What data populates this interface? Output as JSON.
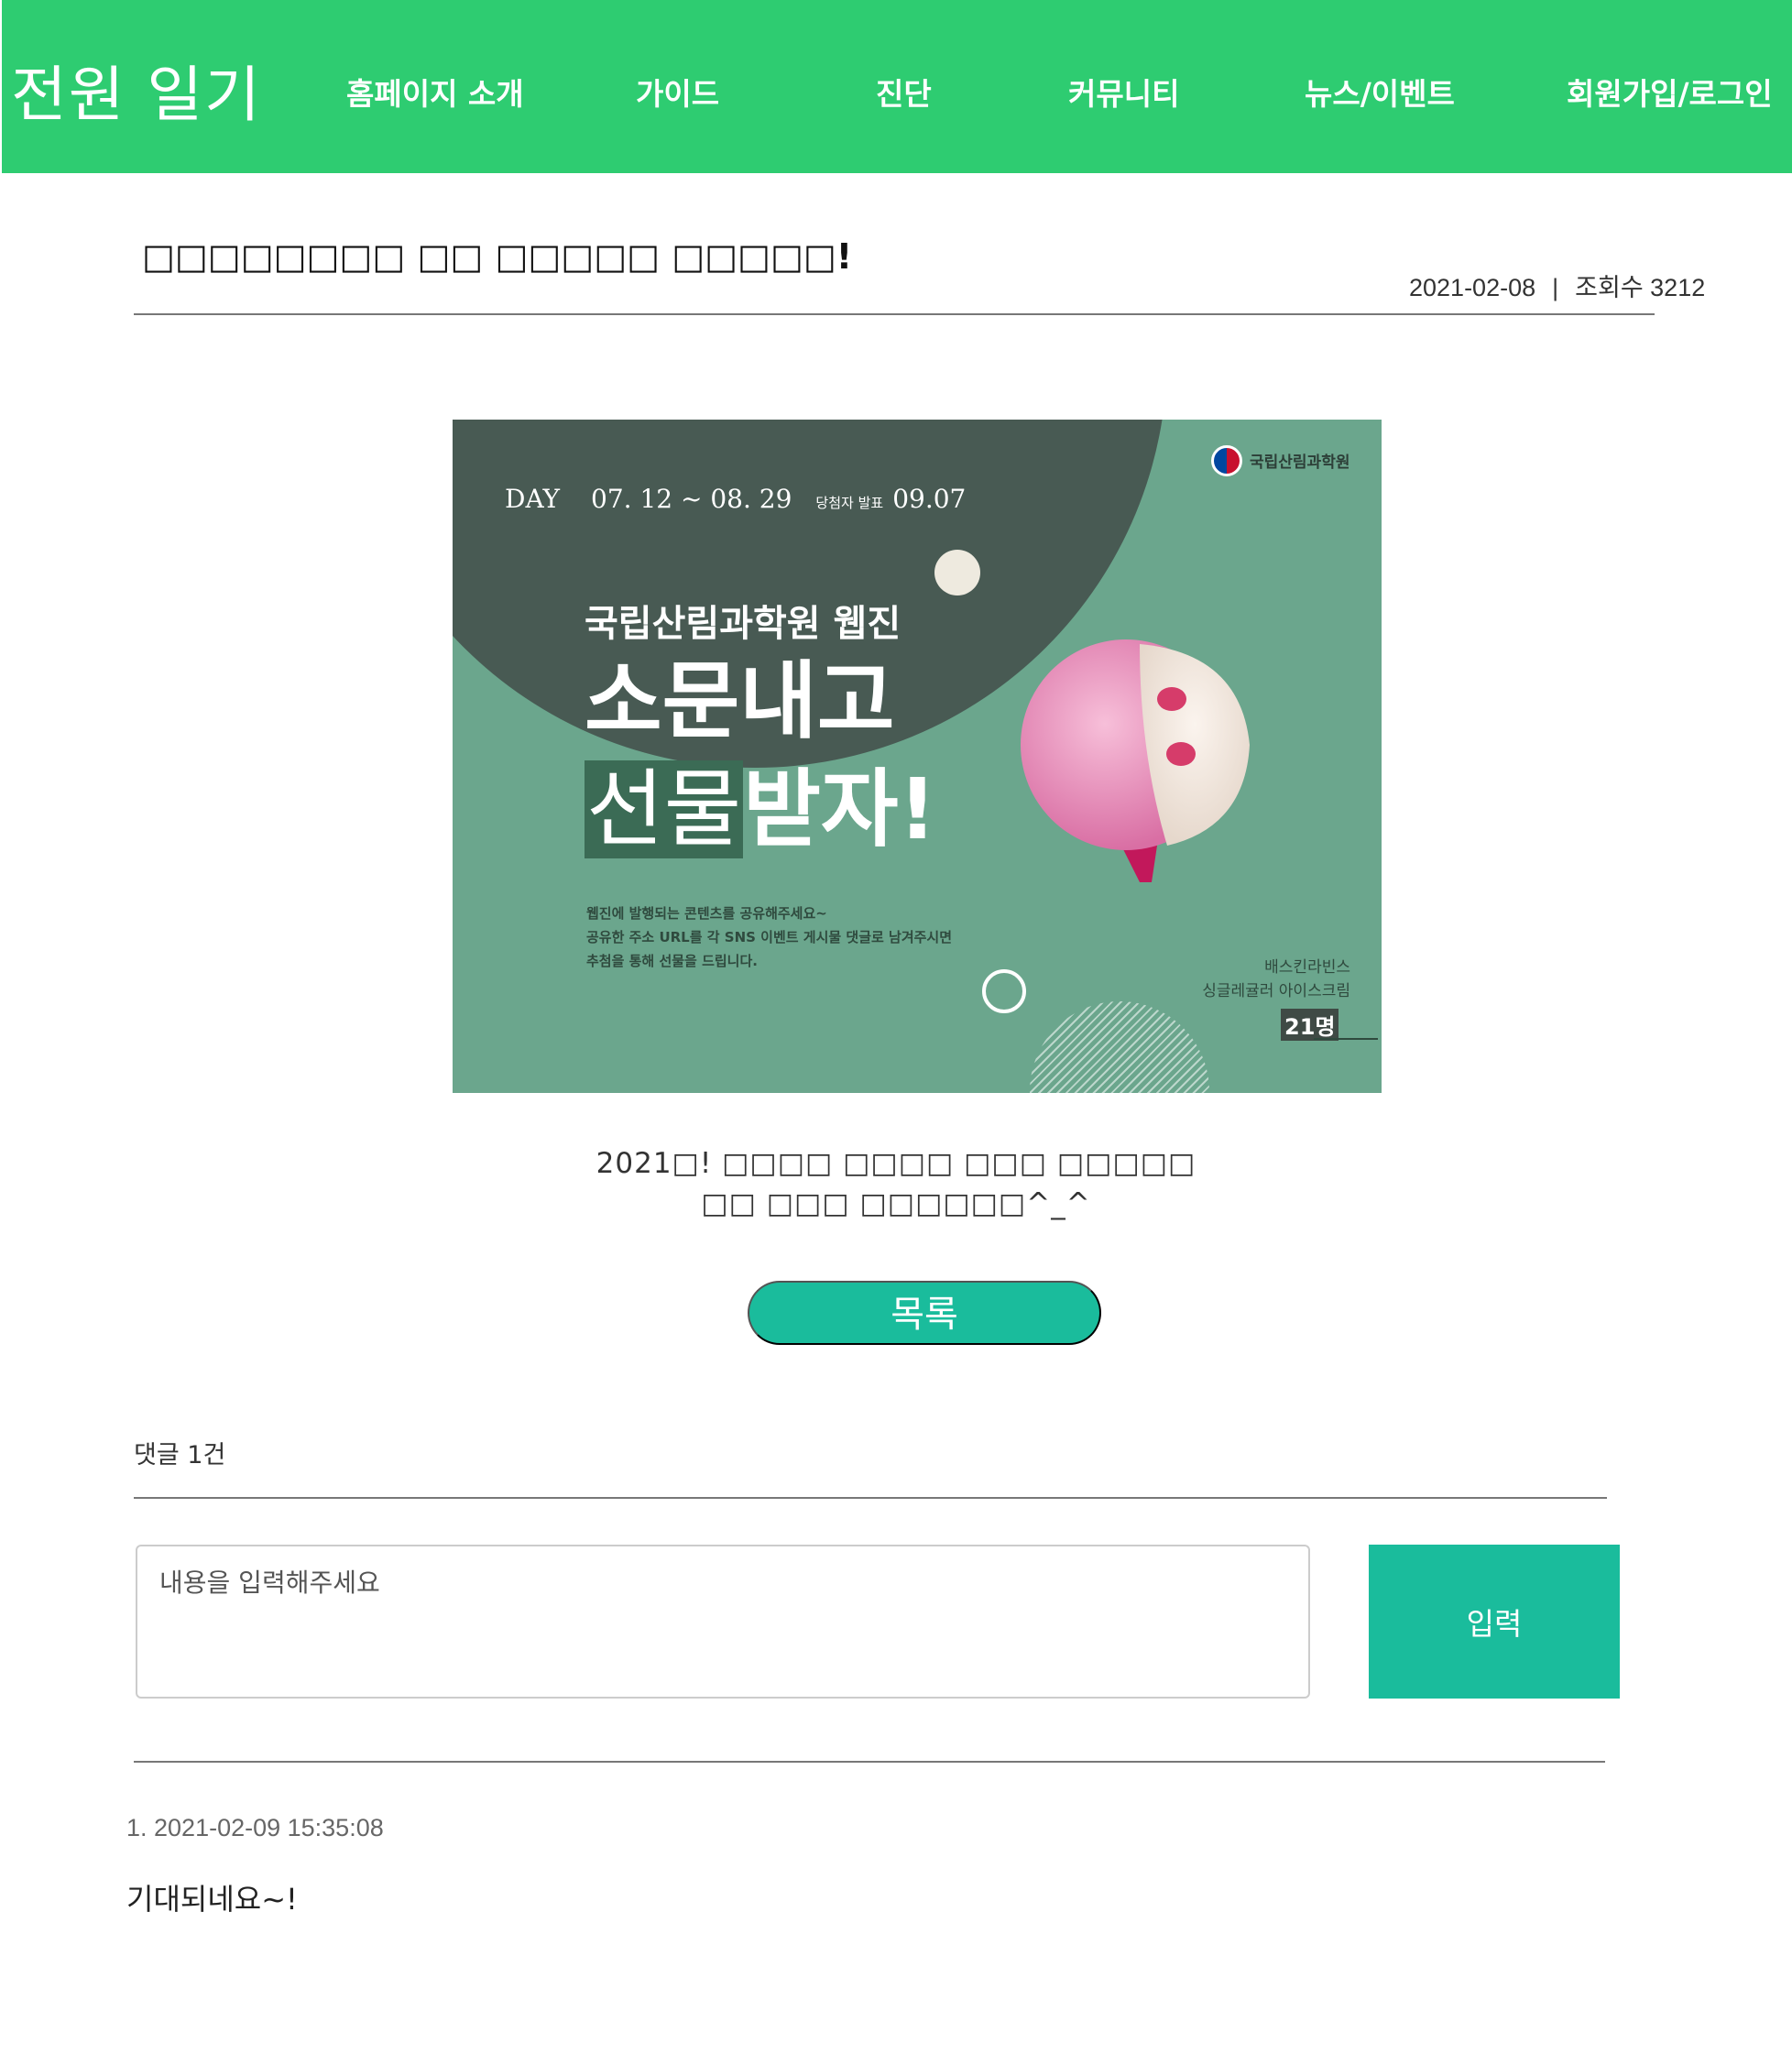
{
  "header": {
    "logo": "전원 일기",
    "nav": [
      "홈페이지 소개",
      "가이드",
      "진단",
      "커뮤니티",
      "뉴스/이벤트",
      "회원가입/로그인"
    ],
    "bg_color": "#2ecc71"
  },
  "post": {
    "title": "□□□□□□□□ □□ □□□□□ □□□□□!",
    "date": "2021-02-08",
    "separator": "|",
    "views": "조회수 3212"
  },
  "banner": {
    "date_label": "DAY",
    "date_range": "07. 12 ~ 08. 29",
    "announce_label": "당첨자 발표",
    "announce_date": "09.07",
    "org": "국립산림과학원",
    "subtitle": "국립산림과학원 웹진",
    "headline_1": "소문내고",
    "headline_2a": "선물",
    "headline_2b": "받자!",
    "desc": [
      "웹진에 발행되는 콘텐츠를 공유해주세요~",
      "공유한 주소 URL를 각 SNS 이벤트 게시물 댓글로 남겨주시면",
      "추첨을 통해 선물을 드립니다."
    ],
    "prize_brand": "배스킨라빈스",
    "prize_item": "싱글레귤러 아이스크림",
    "prize_count": "21명"
  },
  "content": {
    "line1": "2021□! □□□□ □□□□ □□□ □□□□□",
    "line2": "□□ □□□ □□□□□□^_^"
  },
  "list_button": "목록",
  "comments": {
    "count_label": "댓글 1건",
    "input_placeholder": "내용을 입력해주세요",
    "submit_label": "입력",
    "items": [
      {
        "meta": "1. 2021-02-09 15:35:08",
        "text": "기대되네요~!"
      }
    ]
  },
  "colors": {
    "accent": "#1abc9c",
    "header": "#2ecc71",
    "banner_bg": "#6ba68d",
    "banner_dark": "#485a53"
  }
}
